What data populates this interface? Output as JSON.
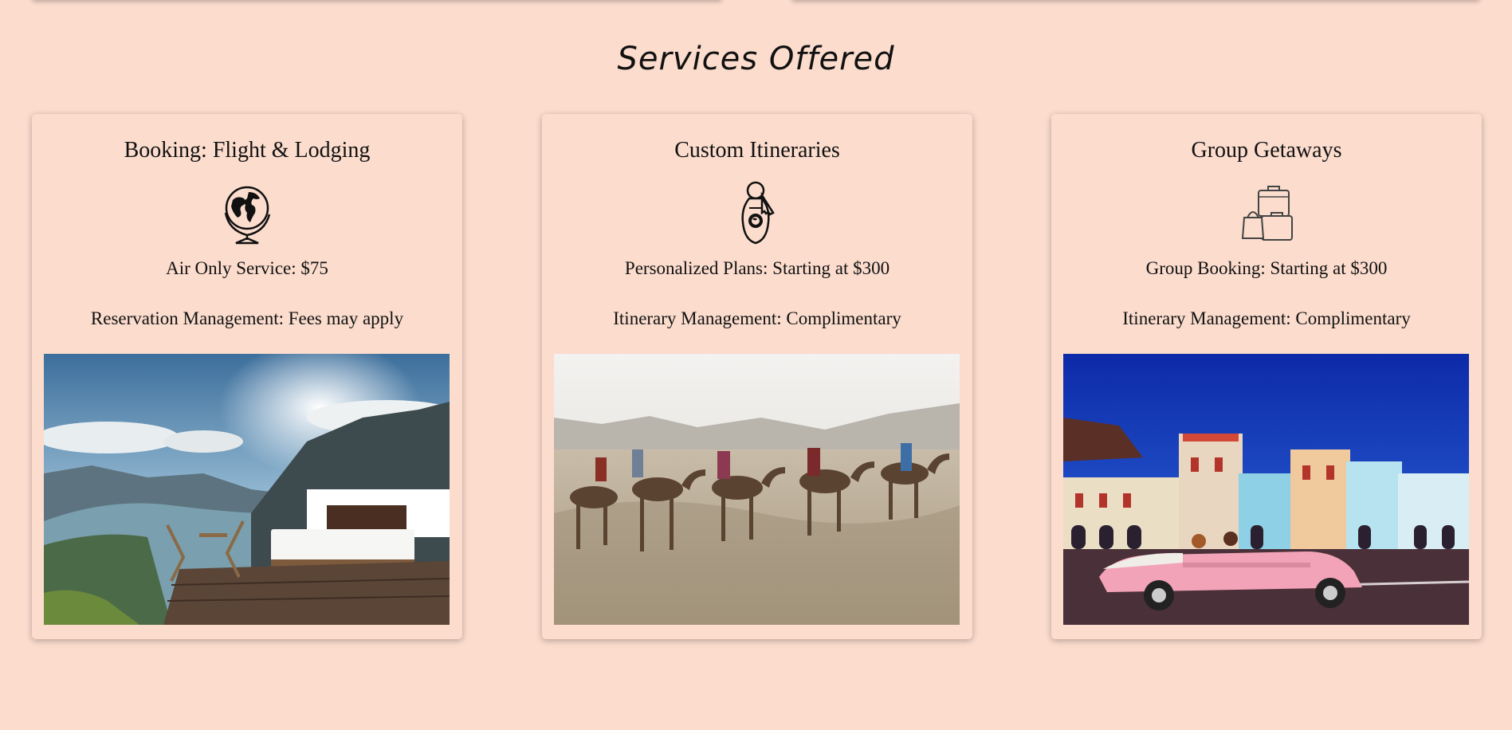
{
  "section": {
    "title": "Services Offered"
  },
  "cards": [
    {
      "title": "Booking: Flight & Lodging",
      "icon": "globe-icon",
      "line1": "Air Only Service: $75",
      "line2": "Reservation Management: Fees may apply",
      "image": "mountain-bed-photo"
    },
    {
      "title": "Custom Itineraries",
      "icon": "hotel-key-icon",
      "line1": "Personalized Plans: Starting at $300",
      "line2": "Itinerary Management: Complimentary",
      "image": "desert-camels-photo"
    },
    {
      "title": "Group Getaways",
      "icon": "luggage-icon",
      "line1": "Group Booking: Starting at $300",
      "line2": "Itinerary Management: Complimentary",
      "image": "havana-car-photo"
    }
  ],
  "colors": {
    "background": "#fbdccd",
    "text": "#111111"
  }
}
